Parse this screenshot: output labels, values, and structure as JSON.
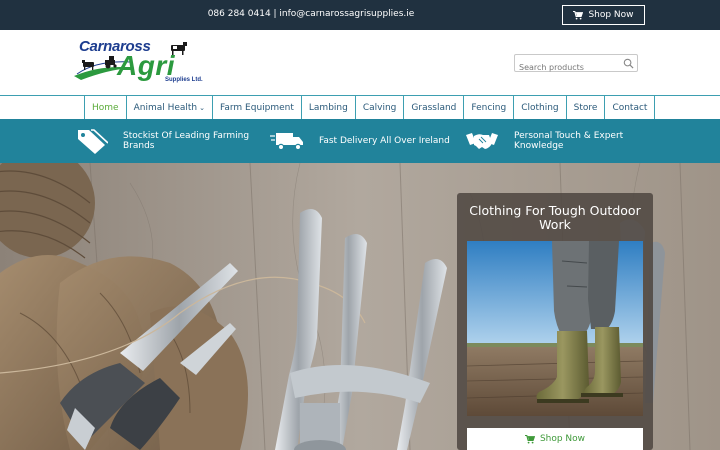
{
  "topbar": {
    "contact": "086 284 0414 | info@carnarossagrisupplies.ie",
    "shop_button": "Shop Now",
    "cart_icon": "cart-icon"
  },
  "logo": {
    "line1": "Carnaross",
    "line2": "Agri",
    "line3": "Supplies Ltd."
  },
  "search": {
    "placeholder": "Search products",
    "icon": "search-icon"
  },
  "nav": {
    "items": [
      {
        "label": "Home",
        "active": true
      },
      {
        "label": "Animal Health",
        "has_dropdown": true
      },
      {
        "label": "Farm Equipment"
      },
      {
        "label": "Lambing"
      },
      {
        "label": "Calving"
      },
      {
        "label": "Grassland"
      },
      {
        "label": "Fencing"
      },
      {
        "label": "Clothing"
      },
      {
        "label": "Store"
      },
      {
        "label": "Contact"
      }
    ]
  },
  "features": [
    {
      "icon": "tags-icon",
      "text": "Stockist Of Leading Farming Brands"
    },
    {
      "icon": "truck-icon",
      "text": "Fast Delivery All Over Ireland"
    },
    {
      "icon": "handshake-icon",
      "text": "Personal Touch & Expert Knowledge"
    }
  ],
  "hero": {
    "card_title": "Clothing For Tough Outdoor Work",
    "card_button": "Shop Now"
  },
  "colors": {
    "topbar": "#203140",
    "band": "#21839b",
    "nav_border": "#3d9fb1",
    "active": "#5bab3a",
    "button_text": "#3f9a3a"
  }
}
